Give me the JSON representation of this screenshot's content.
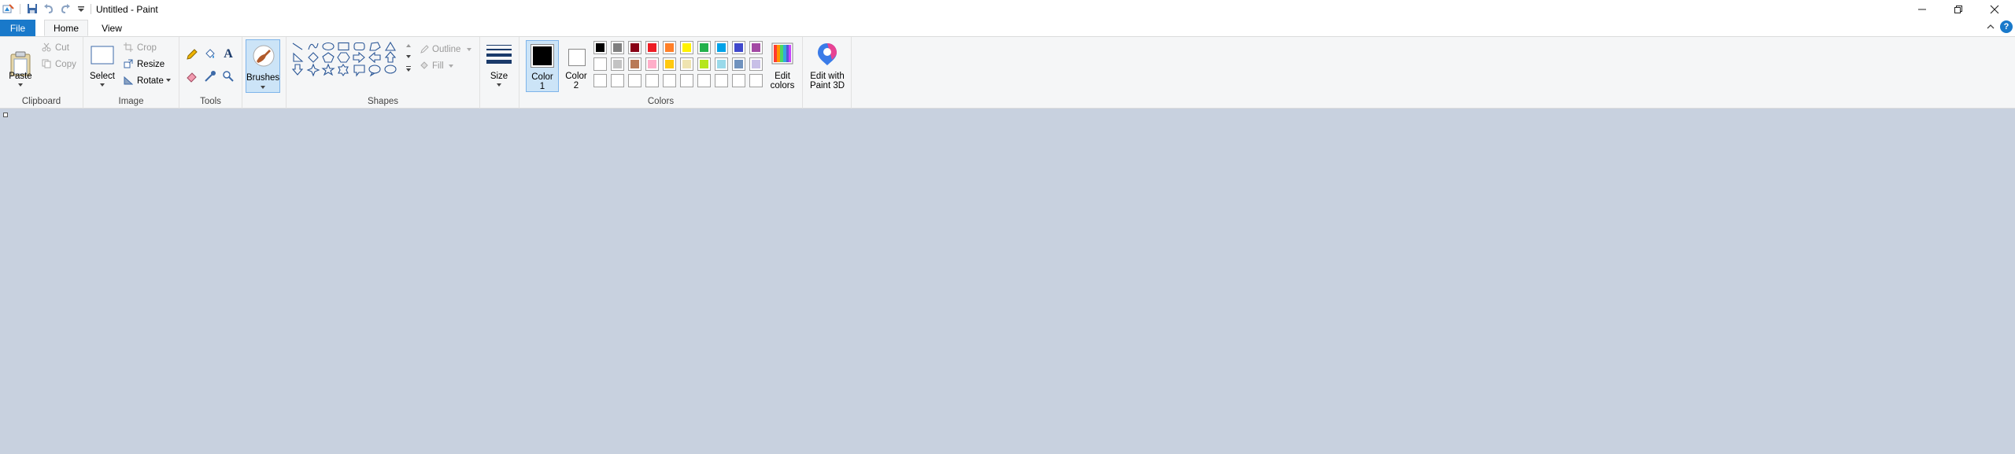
{
  "titlebar": {
    "title": "Untitled - Paint",
    "icons": [
      "paint-app-icon",
      "save-icon",
      "undo-icon",
      "redo-icon",
      "customize-quick-access-icon"
    ],
    "controls": [
      "minimize-icon",
      "restore-icon",
      "close-icon"
    ]
  },
  "tabs": {
    "file": "File",
    "home": "Home",
    "view": "View"
  },
  "ribbon": {
    "clipboard": {
      "paste": "Paste",
      "cut": "Cut",
      "copy": "Copy",
      "group": "Clipboard"
    },
    "image": {
      "select": "Select",
      "crop": "Crop",
      "resize": "Resize",
      "rotate": "Rotate",
      "group": "Image"
    },
    "tools": {
      "group": "Tools"
    },
    "brushes": {
      "label": "Brushes"
    },
    "shapes": {
      "outline": "Outline",
      "fill": "Fill",
      "group": "Shapes"
    },
    "size": {
      "label": "Size"
    },
    "colors": {
      "color1_line1": "Color",
      "color1_line2": "1",
      "color2_line1": "Color",
      "color2_line2": "2",
      "edit_line1": "Edit",
      "edit_line2": "colors",
      "group": "Colors",
      "color1_value": "#000000",
      "color2_value": "#ffffff",
      "palette_row1": [
        "#000000",
        "#7f7f7f",
        "#880015",
        "#ed1c24",
        "#ff7f27",
        "#fff200",
        "#22b14c",
        "#00a2e8",
        "#3f48cc",
        "#a349a4"
      ],
      "palette_row2": [
        "#ffffff",
        "#c3c3c3",
        "#b97a57",
        "#ffaec9",
        "#ffc90e",
        "#efe4b0",
        "#b5e61d",
        "#99d9ea",
        "#7092be",
        "#c8bfe7"
      ],
      "palette_row3": [
        "#ffffff",
        "#ffffff",
        "#ffffff",
        "#ffffff",
        "#ffffff",
        "#ffffff",
        "#ffffff",
        "#ffffff",
        "#ffffff",
        "#ffffff"
      ]
    },
    "paint3d": {
      "line1": "Edit with",
      "line2": "Paint 3D"
    }
  },
  "accent": "#1979ca",
  "canvas_bg": "#c8d1df"
}
